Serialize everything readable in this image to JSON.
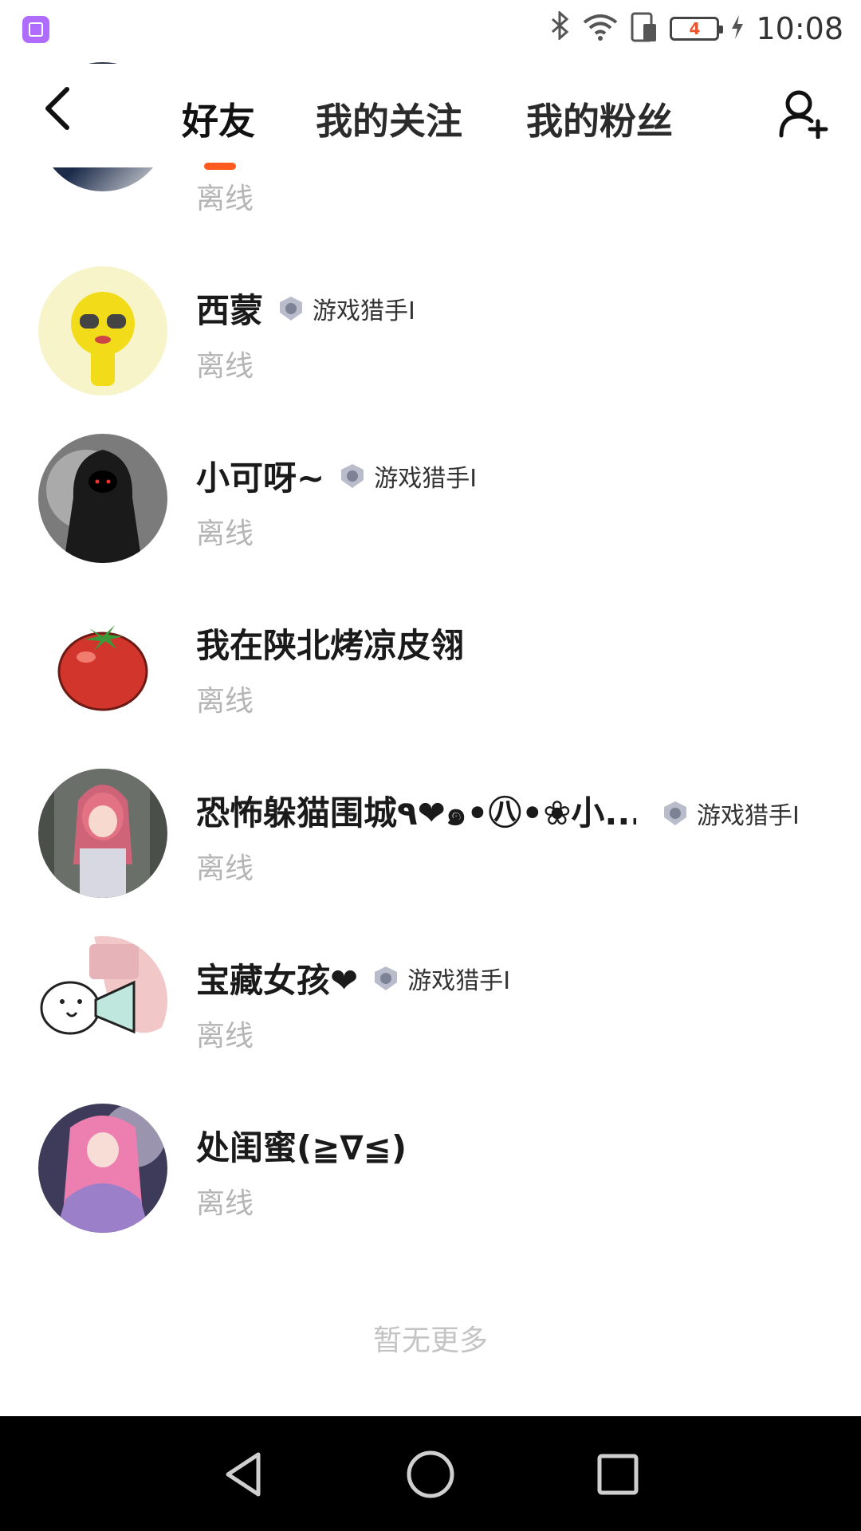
{
  "status_bar": {
    "time": "10:08",
    "battery_level": "4",
    "icons": [
      "app-icon",
      "bluetooth-icon",
      "wifi-icon",
      "sim-icon",
      "battery-icon",
      "charging-icon"
    ]
  },
  "header": {
    "tabs": [
      {
        "label": "好友",
        "active": true
      },
      {
        "label": "我的关注",
        "active": false
      },
      {
        "label": "我的粉丝",
        "active": false
      }
    ],
    "accent_color": "#ff5a1f"
  },
  "friends": [
    {
      "name": "",
      "status": "离线",
      "avatar": "partial-photo-avatar"
    },
    {
      "name": "西蒙",
      "badge": "游戏猎手I",
      "status": "离线",
      "avatar": "yellow-cartoon-avatar"
    },
    {
      "name": "小可呀~",
      "badge": "游戏猎手I",
      "status": "离线",
      "avatar": "hooded-figure-avatar"
    },
    {
      "name": "我在陕北烤凉皮翎",
      "status": "离线",
      "avatar": "tomato-avatar"
    },
    {
      "name": "恐怖躲猫围城٩❤๑•㊇•❀小...",
      "badge": "游戏猎手I",
      "status": "离线",
      "avatar": "anime-girl-avatar"
    },
    {
      "name": "宝藏女孩❤",
      "badge": "游戏猎手I",
      "status": "离线",
      "avatar": "megaphone-cartoon-avatar"
    },
    {
      "name": "处闺蜜(≧∇≦)",
      "status": "离线",
      "avatar": "pink-hair-anime-avatar"
    }
  ],
  "footer_text": "暂无更多",
  "nav_bar": {
    "icons": [
      "back-triangle-icon",
      "home-circle-icon",
      "recent-square-icon"
    ]
  }
}
